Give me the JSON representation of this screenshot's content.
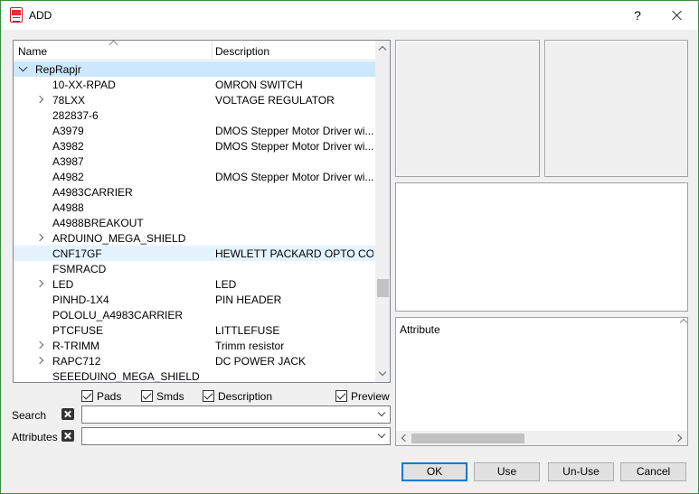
{
  "window": {
    "title": "ADD",
    "help_label": "?",
    "accent": "#0078d7"
  },
  "tree": {
    "columns": {
      "name": "Name",
      "description": "Description"
    },
    "root": {
      "name": "RepRapjr",
      "expanded": true
    },
    "rows": [
      {
        "name": "10-XX-RPAD",
        "desc": "OMRON SWITCH",
        "expandable": false
      },
      {
        "name": "78LXX",
        "desc": "VOLTAGE REGULATOR",
        "expandable": true
      },
      {
        "name": "282837-6",
        "desc": "",
        "expandable": false
      },
      {
        "name": "A3979",
        "desc": "DMOS Stepper Motor Driver wi...",
        "expandable": false
      },
      {
        "name": "A3982",
        "desc": "DMOS Stepper Motor Driver wi...",
        "expandable": false
      },
      {
        "name": "A3987",
        "desc": "",
        "expandable": false
      },
      {
        "name": "A4982",
        "desc": "DMOS Stepper Motor Driver wi...",
        "expandable": false
      },
      {
        "name": "A4983CARRIER",
        "desc": "",
        "expandable": false
      },
      {
        "name": "A4988",
        "desc": "",
        "expandable": false
      },
      {
        "name": "A4988BREAKOUT",
        "desc": "",
        "expandable": false
      },
      {
        "name": "ARDUINO_MEGA_SHIELD",
        "desc": "",
        "expandable": true
      },
      {
        "name": "CNF17GF",
        "desc": "HEWLETT PACKARD OPTO CO...",
        "expandable": false,
        "hover": true
      },
      {
        "name": "FSMRACD",
        "desc": "",
        "expandable": false
      },
      {
        "name": "LED",
        "desc": "LED",
        "expandable": true
      },
      {
        "name": "PINHD-1X4",
        "desc": "PIN HEADER",
        "expandable": false
      },
      {
        "name": "POLOLU_A4983CARRIER",
        "desc": "",
        "expandable": false
      },
      {
        "name": "PTCFUSE",
        "desc": "LITTLEFUSE",
        "expandable": false
      },
      {
        "name": "R-TRIMM",
        "desc": "Trimm resistor",
        "expandable": true
      },
      {
        "name": "RAPC712",
        "desc": "DC POWER JACK",
        "expandable": true
      },
      {
        "name": "SEEEDUINO_MEGA_SHIELD",
        "desc": "",
        "expandable": false
      }
    ]
  },
  "options": {
    "pads": "Pads",
    "smds": "Smds",
    "description": "Description",
    "preview": "Preview"
  },
  "search": {
    "label": "Search",
    "value": ""
  },
  "attributes": {
    "label": "Attributes",
    "value": ""
  },
  "attribute_pane": {
    "header": "Attribute"
  },
  "buttons": {
    "ok": "OK",
    "use": "Use",
    "unuse": "Un-Use",
    "cancel": "Cancel"
  }
}
